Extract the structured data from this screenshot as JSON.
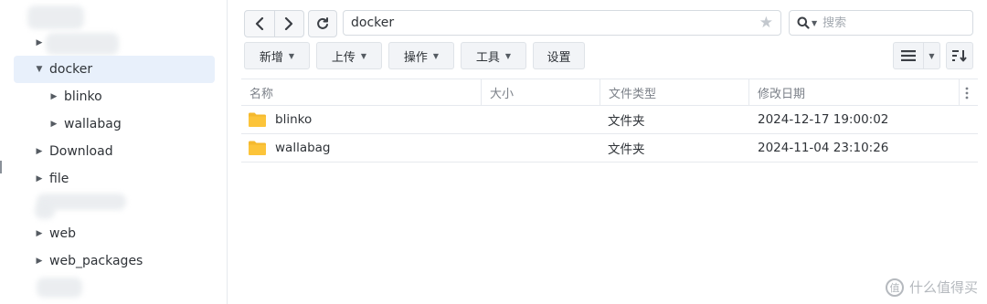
{
  "sidebar": {
    "items": [
      {
        "label": "docker",
        "expanded": true,
        "selected": true,
        "level": 0
      },
      {
        "label": "blinko",
        "expanded": false,
        "selected": false,
        "level": 1
      },
      {
        "label": "wallabag",
        "expanded": false,
        "selected": false,
        "level": 1
      },
      {
        "label": "Download",
        "expanded": false,
        "selected": false,
        "level": 0
      },
      {
        "label": "file",
        "expanded": false,
        "selected": false,
        "level": 0
      },
      {
        "label": "web",
        "expanded": false,
        "selected": false,
        "level": 0
      },
      {
        "label": "web_packages",
        "expanded": false,
        "selected": false,
        "level": 0
      }
    ]
  },
  "topbar": {
    "path": "docker",
    "search_placeholder": "搜索"
  },
  "toolbar": {
    "create": "新增",
    "upload": "上传",
    "action": "操作",
    "tools": "工具",
    "settings": "设置"
  },
  "table": {
    "columns": [
      "名称",
      "大小",
      "文件类型",
      "修改日期"
    ],
    "rows": [
      {
        "name": "blinko",
        "size": "",
        "type": "文件夹",
        "modified": "2024-12-17 19:00:02"
      },
      {
        "name": "wallabag",
        "size": "",
        "type": "文件夹",
        "modified": "2024-11-04 23:10:26"
      }
    ]
  },
  "watermark": "什么值得买",
  "colors": {
    "selected_bg": "#e8f0fb",
    "folder": "#f5b92e",
    "border": "#e6e9ee",
    "button_bg": "#f2f4f7"
  },
  "icons": [
    "chevron-left-icon",
    "chevron-right-icon",
    "refresh-icon",
    "star-icon",
    "search-icon",
    "list-view-icon",
    "sort-icon",
    "folder-icon",
    "more-vertical-icon"
  ]
}
